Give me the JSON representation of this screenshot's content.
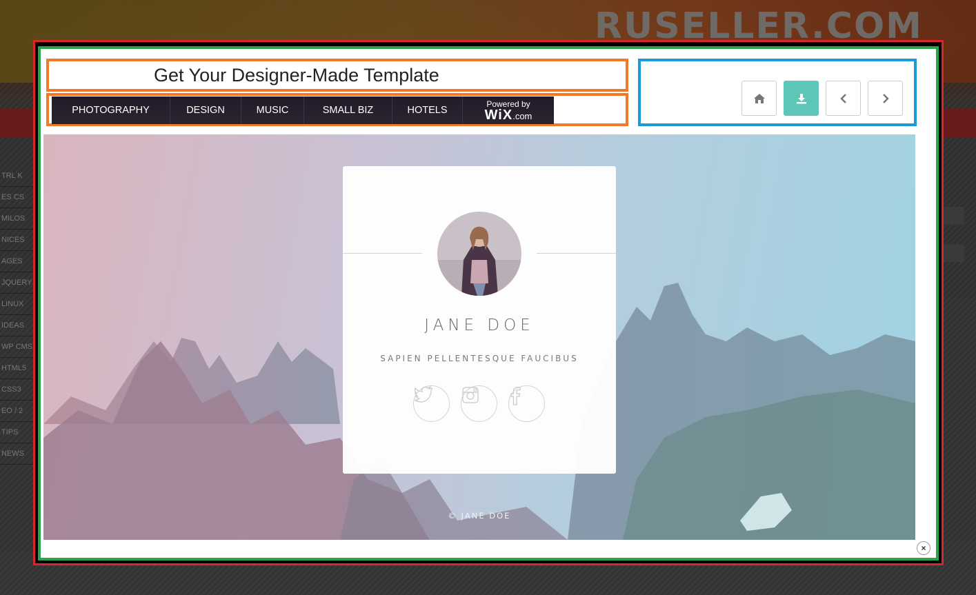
{
  "background_page": {
    "brand": "RUSELLER.COM",
    "left_items": [
      "TRL K",
      "ES CS",
      "MILOS",
      "NICES",
      "AGES",
      "JQUERY",
      "LINUX",
      "IDEAS",
      "WP CMS",
      "HTML5",
      "CSS3",
      "EO / 2",
      "TIPS",
      "NEWS"
    ]
  },
  "banner": {
    "title": "Get Your Designer-Made Template",
    "nav_items": [
      "PHOTOGRAPHY",
      "DESIGN",
      "MUSIC",
      "SMALL BIZ",
      "HOTELS"
    ],
    "powered_by": "Powered by",
    "powered_brand": "WiX",
    "powered_domain": ".com"
  },
  "nav_buttons": [
    {
      "name": "home",
      "icon": "home-icon"
    },
    {
      "name": "download",
      "icon": "download-icon",
      "active": true
    },
    {
      "name": "previous",
      "icon": "chevron-left-icon"
    },
    {
      "name": "next",
      "icon": "chevron-right-icon"
    }
  ],
  "preview": {
    "name": "JANE DOE",
    "subtitle": "SAPIEN PELLENTESQUE FAUCIBUS",
    "social": [
      "twitter-icon",
      "instagram-icon",
      "facebook-icon"
    ],
    "copyright": "© JANE DOE"
  },
  "close_label": "×",
  "colors": {
    "modal_border": "#d8262a",
    "inner_border": "#2aa44a",
    "banner_border": "#f07a2a",
    "nav_panel_border": "#1a9bd7",
    "active_button": "#5cc7b9"
  }
}
